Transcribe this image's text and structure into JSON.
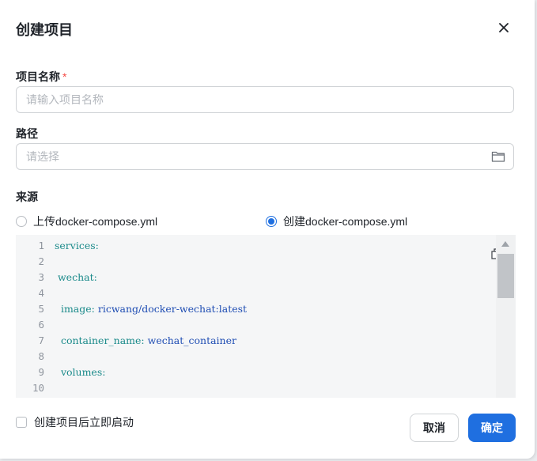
{
  "dialog": {
    "title": "创建项目",
    "close_icon": "close-icon"
  },
  "fields": {
    "name_label": "项目名称",
    "name_required": "*",
    "name_placeholder": "请输入项目名称",
    "path_label": "路径",
    "path_placeholder": "请选择",
    "source_label": "来源"
  },
  "source": {
    "options": [
      {
        "label": "上传docker-compose.yml",
        "selected": false
      },
      {
        "label": "创建docker-compose.yml",
        "selected": true
      }
    ]
  },
  "editor": {
    "line_numbers": [
      "1",
      "2",
      "3",
      "4",
      "5",
      "6",
      "7",
      "8",
      "9",
      "10"
    ],
    "lines": [
      {
        "key": "services:",
        "value": ""
      },
      {
        "key": "",
        "value": ""
      },
      {
        "key": " wechat:",
        "value": ""
      },
      {
        "key": "",
        "value": ""
      },
      {
        "key": "  image:",
        "value": " ricwang/docker-wechat:latest"
      },
      {
        "key": "",
        "value": ""
      },
      {
        "key": "  container_name:",
        "value": " wechat_container"
      },
      {
        "key": "",
        "value": ""
      },
      {
        "key": "  volumes:",
        "value": ""
      },
      {
        "key": "",
        "value": ""
      }
    ],
    "copy_icon": "copy-icon"
  },
  "footer": {
    "autostart_label": "创建项目后立即启动",
    "autostart_checked": false,
    "cancel_label": "取消",
    "ok_label": "确定"
  },
  "colors": {
    "primary": "#1f6fe0",
    "required": "#f54a45",
    "code_key": "#1a8a8a",
    "code_value": "#1f4db3"
  }
}
